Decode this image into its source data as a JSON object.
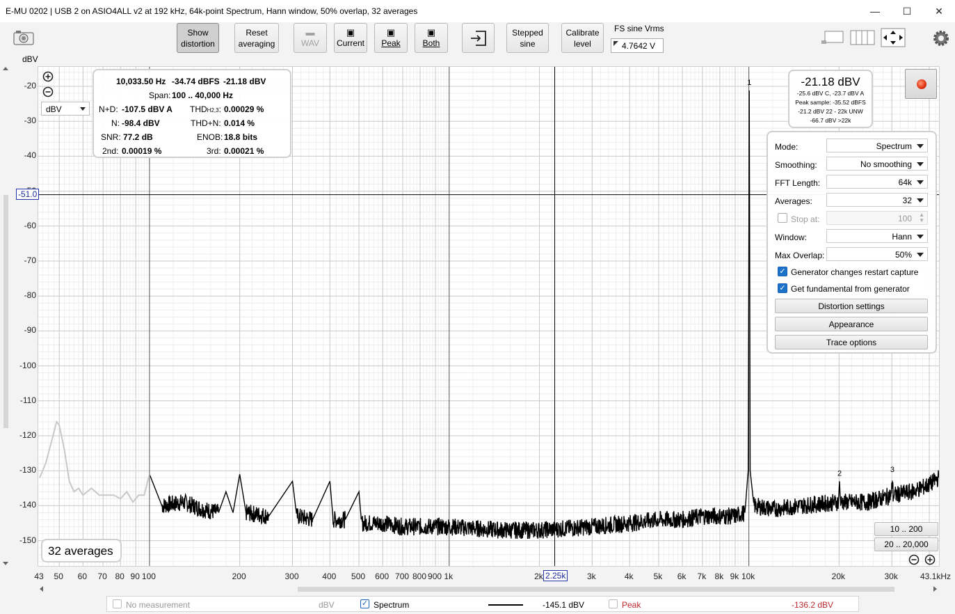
{
  "window": {
    "title": "E-MU 0202 | USB 2 on ASIO4ALL v2 at 192 kHz, 64k-point Spectrum, Hann window, 50% overlap, 32 averages",
    "minimize": "—",
    "maximize": "☐",
    "close": "✕"
  },
  "toolbar": {
    "show_distortion": [
      "Show",
      "distortion"
    ],
    "reset_averaging": [
      "Reset",
      "averaging"
    ],
    "wav": "WAV",
    "current": "Current",
    "peak": "Peak",
    "both": "Both",
    "stepped_sine": [
      "Stepped",
      "sine"
    ],
    "calibrate_level": [
      "Calibrate",
      "level"
    ],
    "fs_label": "FS sine Vrms",
    "fs_value": "4.7642 V"
  },
  "plot": {
    "unit_label": "dBV",
    "unit_select": "dBV",
    "y_ticks": [
      "-20",
      "-30",
      "-40",
      "-50",
      "-60",
      "-70",
      "-80",
      "-90",
      "-100",
      "-110",
      "-120",
      "-130",
      "-140",
      "-150"
    ],
    "x_ticks": [
      "43",
      "50",
      "60",
      "70",
      "80",
      "90",
      "100",
      "200",
      "300",
      "400",
      "500",
      "600",
      "700",
      "800",
      "900",
      "1k",
      "2k",
      "3k",
      "4k",
      "5k",
      "6k",
      "7k",
      "8k",
      "9k",
      "10k",
      "20k",
      "30k",
      "43.1kHz"
    ],
    "y_cursor": "-51.0",
    "x_cursor": "2.25k",
    "averages_badge": "32 averages",
    "peak_markers": [
      "1",
      "2",
      "3"
    ],
    "zoom_presets": [
      "10 .. 200",
      "20 .. 20,000"
    ]
  },
  "chart_data": {
    "type": "line",
    "title": "",
    "xlabel": "",
    "ylabel": "dBV",
    "xscale": "log",
    "xlim": [
      43,
      43100
    ],
    "ylim": [
      -155,
      -15
    ],
    "grid": true,
    "series": [
      {
        "name": "Spectrum",
        "color": "#000000",
        "points": [
          [
            100,
            -131
          ],
          [
            110,
            -140
          ],
          [
            130,
            -139
          ],
          [
            150,
            -141
          ],
          [
            170,
            -142
          ],
          [
            180,
            -136
          ],
          [
            190,
            -142
          ],
          [
            200,
            -131
          ],
          [
            210,
            -142
          ],
          [
            250,
            -143
          ],
          [
            300,
            -133
          ],
          [
            310,
            -143
          ],
          [
            350,
            -144
          ],
          [
            400,
            -133
          ],
          [
            410,
            -144
          ],
          [
            450,
            -144
          ],
          [
            500,
            -136
          ],
          [
            510,
            -145
          ],
          [
            600,
            -145
          ],
          [
            700,
            -146
          ],
          [
            800,
            -146
          ],
          [
            1000,
            -146
          ],
          [
            1500,
            -147
          ],
          [
            2000,
            -147
          ],
          [
            3000,
            -146
          ],
          [
            4000,
            -145
          ],
          [
            5000,
            -144
          ],
          [
            6000,
            -144
          ],
          [
            7000,
            -143
          ],
          [
            8000,
            -143
          ],
          [
            9000,
            -143
          ],
          [
            9700,
            -142
          ],
          [
            9950,
            -130
          ],
          [
            10033,
            -21.2
          ],
          [
            10100,
            -130
          ],
          [
            10400,
            -140
          ],
          [
            12000,
            -141
          ],
          [
            15000,
            -140
          ],
          [
            19900,
            -139
          ],
          [
            20066,
            -133
          ],
          [
            20200,
            -139
          ],
          [
            25000,
            -139
          ],
          [
            29900,
            -137
          ],
          [
            30100,
            -132
          ],
          [
            30300,
            -137
          ],
          [
            35000,
            -136
          ],
          [
            40000,
            -134
          ],
          [
            43100,
            -132
          ]
        ]
      },
      {
        "name": "",
        "color": "#c8c8c8",
        "points": [
          [
            43,
            -132
          ],
          [
            45,
            -128
          ],
          [
            47,
            -122
          ],
          [
            49,
            -116
          ],
          [
            50,
            -117
          ],
          [
            52,
            -124
          ],
          [
            54,
            -133
          ],
          [
            56,
            -136
          ],
          [
            58,
            -135
          ],
          [
            60,
            -137
          ],
          [
            64,
            -135
          ],
          [
            68,
            -137
          ],
          [
            72,
            -137
          ],
          [
            76,
            -137
          ],
          [
            80,
            -138
          ],
          [
            84,
            -136
          ],
          [
            88,
            -139
          ],
          [
            92,
            -137
          ],
          [
            96,
            -137
          ],
          [
            100,
            -131
          ]
        ]
      }
    ],
    "legend": [
      {
        "label": "No measurement",
        "unit": "dBV",
        "checked": false
      },
      {
        "label": "Spectrum",
        "value": "-145.1 dBV",
        "checked": true
      },
      {
        "label": "Peak",
        "value": "-136.2 dBV",
        "checked": false
      }
    ]
  },
  "readout": {
    "freq": "10,033.50 Hz",
    "dbfs": "-34.74 dBFS",
    "dbv": "-21.18 dBV",
    "span_label": "Span:",
    "span": "100 .. 40,000 Hz",
    "nd_label": "N+D:",
    "nd": "-107.5 dBV A",
    "thd_label": "THD",
    "thd_sub": "H2,3",
    "thd_colon": ":",
    "thd": "0.00029 %",
    "n_label": "N:",
    "n": "-98.4 dBV",
    "thdn_label": "THD+N:",
    "thdn": "0.014 %",
    "snr_label": "SNR:",
    "snr": "77.2 dB",
    "enob_label": "ENOB:",
    "enob": "18.8 bits",
    "second_label": "2nd:",
    "second": "0.00019 %",
    "third_label": "3rd:",
    "third": "0.00021 %"
  },
  "level": {
    "main": "-21.18 dBV",
    "lines": [
      "-25.6 dBV C, -23.7 dBV A",
      "Peak sample: -35.52 dBFS",
      "-21.2 dBV 22 - 22k UNW",
      "-66.7 dBV >22k"
    ]
  },
  "controls": {
    "mode_label": "Mode:",
    "mode": "Spectrum",
    "smoothing_label": "Smoothing:",
    "smoothing": "No smoothing",
    "fft_label": "FFT Length:",
    "fft": "64k",
    "averages_label": "Averages:",
    "averages": "32",
    "stop_label": "Stop at:",
    "stop": "100",
    "window_label": "Window:",
    "window_value": "Hann",
    "overlap_label": "Max Overlap:",
    "overlap": "50%",
    "gen_restart": "Generator changes restart capture",
    "gen_fund": "Get fundamental from generator",
    "distortion_settings": "Distortion settings",
    "appearance": "Appearance",
    "trace_options": "Trace options"
  }
}
